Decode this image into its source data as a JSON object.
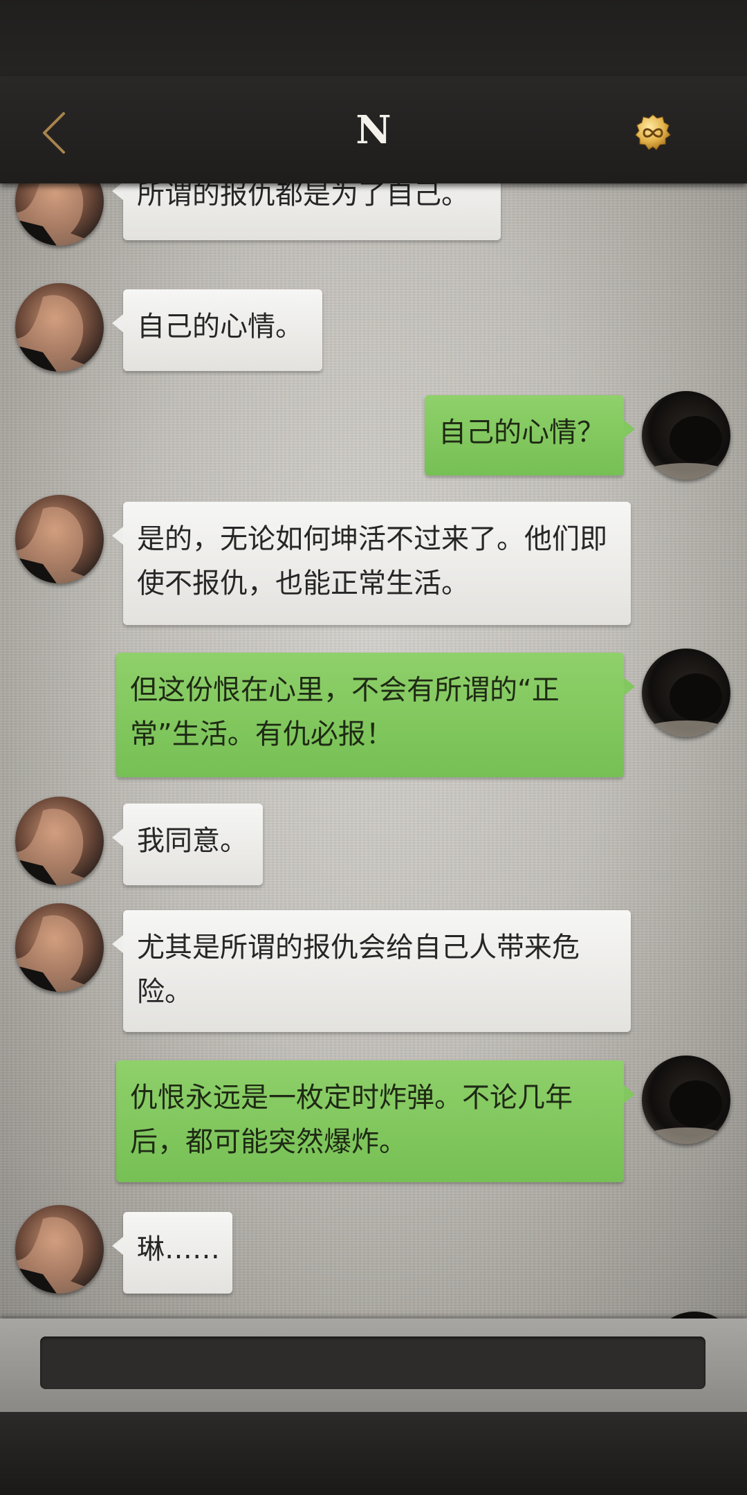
{
  "header": {
    "title": "N",
    "back_icon": "chevron-left-icon",
    "badge_icon": "infinity-coin-icon",
    "accent_color": "#b08a4c"
  },
  "colors": {
    "outgoing_bubble": "#82c75f",
    "incoming_bubble": "#eeeeec"
  },
  "messages": [
    {
      "from": "contact",
      "text": "所谓的报仇都是为了自己。"
    },
    {
      "from": "contact",
      "text": "自己的心情。"
    },
    {
      "from": "me",
      "text": "自己的心情？"
    },
    {
      "from": "contact",
      "text": "是的，无论如何坤活不过来了。他们即使不报仇，也能正常生活。"
    },
    {
      "from": "me",
      "text": "但这份恨在心里，不会有所谓的“正常”生活。有仇必报！"
    },
    {
      "from": "contact",
      "text": "我同意。"
    },
    {
      "from": "contact",
      "text": "尤其是所谓的报仇会给自己人带来危险。"
    },
    {
      "from": "me",
      "text": "仇恨永远是一枚定时炸弹。不论几年后，都可能突然爆炸。"
    },
    {
      "from": "contact",
      "text": "琳……"
    }
  ],
  "input": {
    "value": "",
    "placeholder": ""
  }
}
